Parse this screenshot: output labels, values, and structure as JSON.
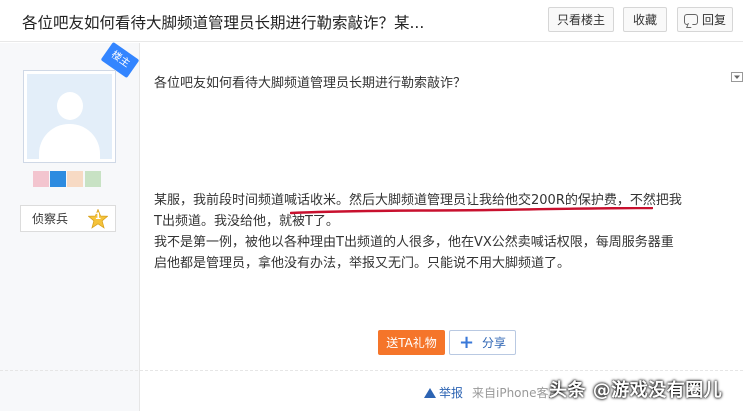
{
  "header": {
    "title": "各位吧友如何看待大脚频道管理员长期进行勒索敲诈？某...",
    "buttons": {
      "only_op": "只看楼主",
      "favorite": "收藏",
      "reply": "回复"
    }
  },
  "sidebar": {
    "corner_badge": "楼主",
    "level_name": "侦察兵",
    "level_number": "1",
    "colors": {
      "accent": "#3385ff",
      "level_badge": "#f5c33b"
    }
  },
  "post": {
    "question": "各位吧友如何看待大脚频道管理员长期进行勒索敲诈？",
    "lines": [
      "某服，我前段时间频道喊话收米。然后大脚频道管理员让我给他交200R的保护费，不然把我",
      "T出频道。我没给他，就被T了。",
      "我不是第一例，被他以各种理由T出频道的人很多，他在VX公然卖喊话权限，每周服务器重",
      "启他都是管理员，拿他没有办法，举报又无门。只能说不用大脚频道了。"
    ],
    "buttons": {
      "gift": "送TA礼物",
      "share": "分享"
    }
  },
  "footer": {
    "report": "举报",
    "from": "来自iPhone客户",
    "watermark": "头条 @游戏没有圈儿"
  }
}
